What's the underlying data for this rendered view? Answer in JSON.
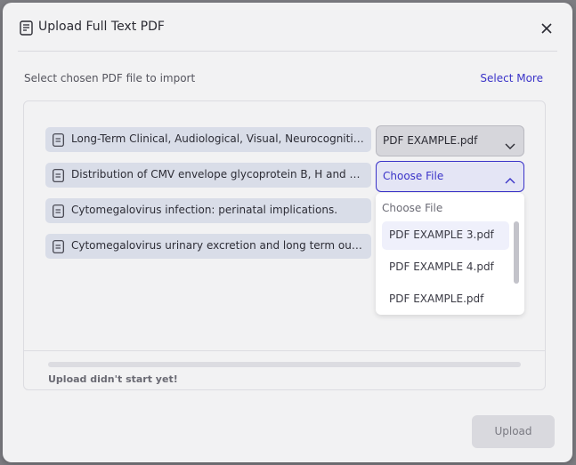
{
  "dialog": {
    "title": "Upload Full Text PDF",
    "instruction": "Select chosen PDF file to import",
    "select_more": "Select More",
    "upload_label": "Upload",
    "status": "Upload didn't start yet!",
    "progress_percent": 0
  },
  "files": [
    {
      "name": "Long-Term Clinical, Audiological, Visual, Neurocognitive and Behavioral Outcome in Children With Symptomatic and Asymptomatic Congenital Cytomegalovirus Infection",
      "selected": "PDF EXAMPLE.pdf"
    },
    {
      "name": "Distribution of CMV envelope glycoprotein B, H and N genotypes in infants with congenital cytomegalovirus symptomatic infection",
      "selected": "Choose File"
    },
    {
      "name": "Cytomegalovirus infection: perinatal implications.",
      "selected": ""
    },
    {
      "name": "Cytomegalovirus urinary excretion and long term outcome in children with congenital cytomegalovirus infection",
      "selected": ""
    }
  ],
  "dropdown": {
    "header": "Choose File",
    "options": [
      "PDF EXAMPLE 3.pdf",
      "PDF EXAMPLE 4.pdf",
      "PDF EXAMPLE.pdf"
    ],
    "highlighted_index": 0
  },
  "colors": {
    "accent": "#3a33c8",
    "file_row_bg": "#d9dde8",
    "modal_bg": "#f2f2f3"
  },
  "icons": {
    "header": "document-icon",
    "close": "close-icon",
    "file": "file-icon",
    "chevron_down": "chevron-down-icon",
    "chevron_up": "chevron-up-icon"
  }
}
